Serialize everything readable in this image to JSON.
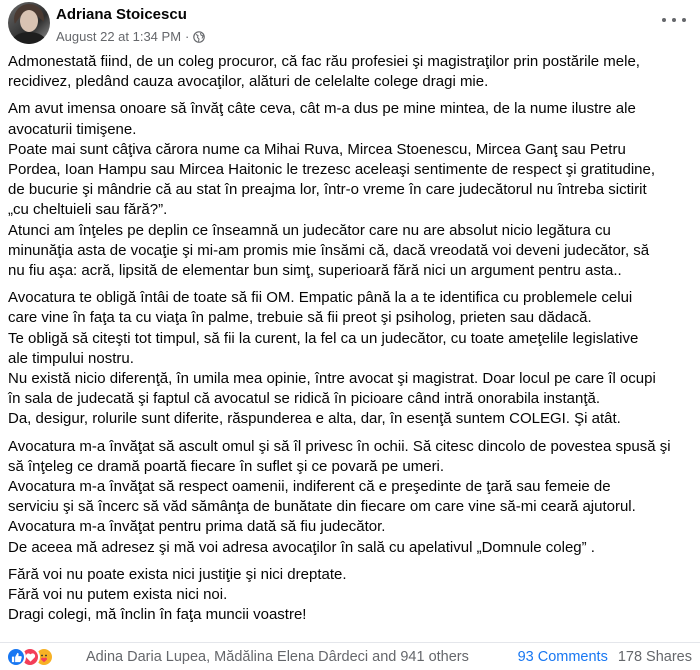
{
  "post": {
    "author": "Adriana Stoicescu",
    "timestamp": "August 22 at 1:34 PM",
    "separator": "·",
    "privacy_icon": "globe-icon",
    "more_icon": "more-options-icon"
  },
  "paragraphs": [
    {
      "lines": [
        "Admonestată fiind, de un coleg procuror, că fac rău profesiei şi magistraţilor prin postările mele,",
        "recidivez, pledând cauza avocaţilor, alături de celelalte colege dragi mie."
      ]
    },
    {
      "lines": [
        "Am avut imensa onoare  să învăţ câte ceva, cât m-a dus pe mine mintea, de la nume ilustre ale",
        "avocaturii timişene.",
        "Poate mai sunt câţiva cărora nume ca Mihai Ruva, Mircea Stoenescu, Mircea Ganţ sau Petru",
        "Pordea, Ioan Hampu sau Mircea Haitonic le trezesc aceleaşi sentimente de respect şi gratitudine,",
        "de bucurie şi mândrie că au stat în preajma lor,  într-o vreme în care judecătorul nu întreba sictirit",
        "„cu cheltuieli sau fără?”.",
        "Atunci am înţeles pe deplin ce înseamnă un judecător care nu are absolut nicio legătura cu",
        "minunăţia asta de vocaţie şi mi-am promis mie însămi că, dacă vreodată voi deveni judecător, să",
        "nu fiu aşa: acră, lipsită de elementar bun simţ, superioară fără nici un argument pentru asta.."
      ]
    },
    {
      "lines": [
        "Avocatura te obligă întâi de toate să fii OM. Empatic până la a te identifica cu problemele celui",
        "care vine în faţa ta cu viaţa în palme, trebuie să fii preot şi psiholog, prieten sau dădacă.",
        "Te obligă să citeşti tot timpul, să fii la curent, la fel ca un judecător, cu toate ameţelile legislative",
        "ale timpului nostru.",
        "Nu există nicio diferenţă, în umila mea opinie, între avocat şi magistrat. Doar locul pe care îl ocupi",
        "în sala de judecată şi faptul că avocatul se ridică în picioare când intră onorabila instanţă.",
        "Da, desigur, rolurile sunt diferite, răspunderea e alta, dar, în esenţă suntem COLEGI. Şi atât."
      ]
    },
    {
      "lines": [
        "Avocatura m-a învăţat să ascult omul şi să îl privesc în ochii. Să citesc dincolo de povestea spusă şi",
        "să înţeleg ce dramă poartă fiecare în suflet şi ce povară pe umeri.",
        "Avocatura m-a învăţat să respect oamenii, indiferent că e preşedinte de ţară sau femeie de",
        "serviciu şi să încerc să văd sămânţa de bunătate din fiecare om care vine să-mi ceară ajutorul.",
        "Avocatura m-a învăţat  pentru prima dată să fiu judecător.",
        "De aceea mă adresez şi mă voi adresa avocaţilor în sală cu apelativul „Domnule coleg” ."
      ]
    },
    {
      "lines": [
        "Fără voi nu poate exista nici justiţie şi nici dreptate.",
        "Fără voi nu putem exista nici noi.",
        "Dragi colegi, mă înclin în faţa muncii voastre!"
      ]
    }
  ],
  "footer": {
    "reaction_icons": [
      "like-icon",
      "love-icon",
      "care-icon"
    ],
    "reactors": "Adina Daria Lupea, Mădălina Elena Dârdeci and 941 others",
    "comments": "93 Comments",
    "shares": "178 Shares"
  },
  "colors": {
    "secondary_text": "#65676b",
    "link_blue": "#1877f2",
    "like_blue": "#1877f2",
    "love_red": "#f33e58",
    "care_yellow": "#f7b125"
  }
}
